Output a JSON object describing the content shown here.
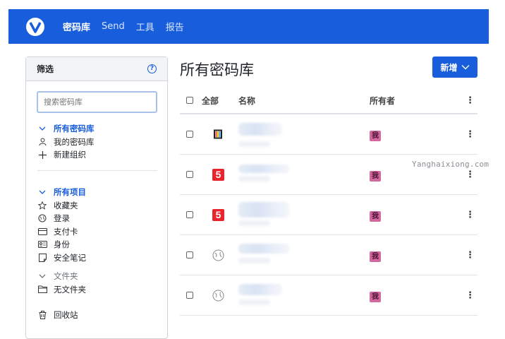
{
  "nav": {
    "items": [
      "密码库",
      "Send",
      "工具",
      "报告"
    ]
  },
  "sidebar": {
    "title": "筛选",
    "help_icon": "?",
    "search_placeholder": "搜索密码库",
    "vaults": {
      "header": "所有密码库",
      "items": [
        {
          "icon": "user-icon",
          "label": "我的密码库"
        },
        {
          "icon": "plus-icon",
          "label": "新建组织"
        }
      ]
    },
    "types": {
      "header": "所有项目",
      "items": [
        {
          "icon": "star-icon",
          "label": "收藏夹"
        },
        {
          "icon": "globe-icon",
          "label": "登录"
        },
        {
          "icon": "card-icon",
          "label": "支付卡"
        },
        {
          "icon": "id-card-icon",
          "label": "身份"
        },
        {
          "icon": "note-icon",
          "label": "安全笔记"
        }
      ]
    },
    "folders": {
      "header": "文件夹",
      "items": [
        {
          "icon": "folder-icon",
          "label": "无文件夹"
        }
      ]
    },
    "trash": {
      "icon": "trash-icon",
      "label": "回收站"
    }
  },
  "main": {
    "title": "所有密码库",
    "new_button": "新增",
    "table": {
      "headers": {
        "all": "全部",
        "name": "名称",
        "owner": "所有者"
      },
      "rows": [
        {
          "icon": "film-icon",
          "owner": "我"
        },
        {
          "icon": "five-icon",
          "owner": "我"
        },
        {
          "icon": "five-icon",
          "owner": "我"
        },
        {
          "icon": "globe-icon",
          "owner": "我"
        },
        {
          "icon": "globe-icon",
          "owner": "我"
        }
      ]
    }
  },
  "watermark": "Yanghaixiong.com",
  "colors": {
    "brand": "#175ddc",
    "owner_badge": "#d2699e",
    "icon_five": "#e8242c"
  }
}
